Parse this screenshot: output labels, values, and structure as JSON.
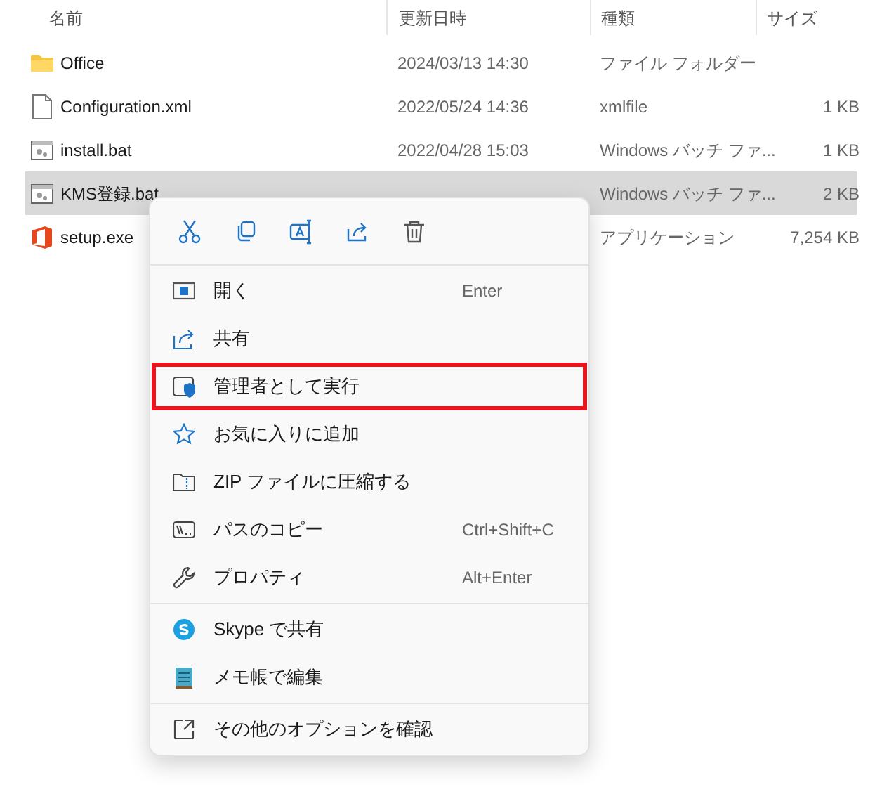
{
  "columns": [
    "名前",
    "更新日時",
    "種類",
    "サイズ"
  ],
  "files": [
    {
      "kind": "folder",
      "name": "Office",
      "date": "2024/03/13 14:30",
      "type": "ファイル フォルダー",
      "selected": false
    },
    {
      "kind": "document",
      "name": "Configuration.xml",
      "date": "2022/05/24 14:36",
      "type": "xmlfile",
      "size": "1 KB",
      "selected": false
    },
    {
      "kind": "batch",
      "name": "install.bat",
      "date": "2022/04/28 15:03",
      "type": "Windows バッチ ファ...",
      "size": "1 KB",
      "selected": false
    },
    {
      "kind": "batch",
      "name": "KMS登録.bat",
      "type": "Windows バッチ ファ...",
      "size": "2 KB",
      "selected": true
    },
    {
      "kind": "office",
      "name": "setup.exe",
      "type": "アプリケーション",
      "size": "7,254 KB",
      "selected": false
    }
  ],
  "context_menu": {
    "groups": [
      [
        {
          "label": "開く",
          "shortcut": "Enter",
          "highlighted": false
        },
        {
          "label": "共有",
          "highlighted": false
        },
        {
          "label": "管理者として実行",
          "highlighted": true
        },
        {
          "label": "お気に入りに追加",
          "highlighted": false
        },
        {
          "label": "ZIP ファイルに圧縮する",
          "highlighted": false
        },
        {
          "label": "パスのコピー",
          "shortcut": "Ctrl+Shift+C",
          "highlighted": false
        },
        {
          "label": "プロパティ",
          "shortcut": "Alt+Enter",
          "highlighted": false
        }
      ],
      [
        {
          "label": "Skype で共有",
          "highlighted": false
        },
        {
          "label": "メモ帳で編集",
          "highlighted": false
        }
      ],
      [
        {
          "label": "その他のオプションを確認",
          "highlighted": false
        }
      ]
    ]
  }
}
